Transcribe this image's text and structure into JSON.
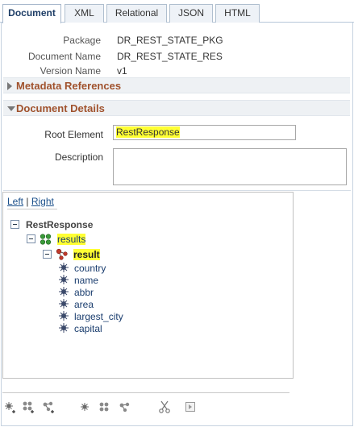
{
  "tabs": [
    {
      "label": "Document",
      "active": true
    },
    {
      "label": "XML",
      "active": false
    },
    {
      "label": "Relational",
      "active": false
    },
    {
      "label": "JSON",
      "active": false
    },
    {
      "label": "HTML",
      "active": false
    }
  ],
  "meta": {
    "package_label": "Package",
    "package_value": "DR_REST_STATE_PKG",
    "document_name_label": "Document Name",
    "document_name_value": "DR_REST_STATE_RES",
    "version_name_label": "Version Name",
    "version_name_value": "v1"
  },
  "sections": {
    "metadata_references": "Metadata References",
    "document_details": "Document Details"
  },
  "details": {
    "root_element_label": "Root Element",
    "root_element_value": "RestResponse",
    "description_label": "Description",
    "description_value": ""
  },
  "tree_panel": {
    "left_link": "Left",
    "separator": "|",
    "right_link": "Right",
    "root": "RestResponse",
    "collection": "results",
    "compound": "result",
    "elements": [
      "country",
      "name",
      "abbr",
      "area",
      "largest_city",
      "capital"
    ]
  },
  "toolbar_icons": [
    "add-element-icon",
    "add-collection-icon",
    "add-compound-icon",
    "insert-element-icon",
    "insert-collection-icon",
    "insert-compound-icon",
    "cut-icon",
    "paste-icon"
  ],
  "colors": {
    "highlight": "#ffff33",
    "section_title": "#a0522d",
    "link": "#1a4f8a",
    "node_text": "#1a3d6e"
  }
}
